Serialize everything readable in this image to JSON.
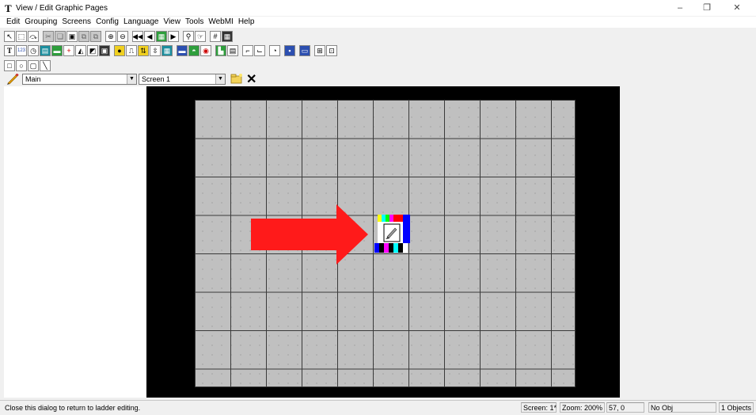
{
  "window": {
    "app_icon": "T",
    "title": "View / Edit Graphic Pages",
    "minimize": "–",
    "restore": "❐",
    "close": "✕"
  },
  "menu": [
    "Edit",
    "Grouping",
    "Screens",
    "Config",
    "Language",
    "View",
    "Tools",
    "WebMI",
    "Help"
  ],
  "toolbar_icons": {
    "row1": [
      "pointer-icon",
      "select-rect-icon",
      "connect-icon",
      "cut-icon",
      "copy-icon",
      "paste-icon",
      "duplicate-icon",
      "paste-special-icon",
      "zoom-in-icon",
      "zoom-out-icon",
      "first-screen-icon",
      "prev-screen-icon",
      "screen-list-icon",
      "next-screen-icon",
      "find-icon",
      "properties-icon",
      "grid-icon",
      "snap-grid-icon"
    ],
    "row2": [
      "text-tool-icon",
      "numeric-tool-icon",
      "clock-tool-icon",
      "data-tool-icon",
      "bitmap-tool-icon",
      "alarm-tool-icon",
      "gauge-tool-icon",
      "chart-tool-icon",
      "button-tool-icon",
      "light-tool-icon",
      "switch-tool-icon",
      "slider-tool-icon",
      "meter-tool-icon",
      "indicator-tool-icon",
      "sensor-tool-icon",
      "tank-tool-icon",
      "input-tool-icon",
      "display-tool-icon",
      "trend-tool-icon",
      "xy-plot-icon",
      "timer-tool-icon",
      "save-tool-icon",
      "message-tool-icon",
      "table-tool-icon",
      "frame-tool-icon"
    ],
    "row3": [
      "rectangle-tool-icon",
      "circle-tool-icon",
      "rounded-rect-tool-icon",
      "line-tool-icon"
    ]
  },
  "selectors": {
    "page": "Main",
    "screen": "Screen 1"
  },
  "status": {
    "message": "Close this dialog to return to ladder editing.",
    "screen": "Screen: 1*",
    "zoom": "Zoom: 200%",
    "coords": "57, 0",
    "object": "No Obj",
    "objects": "1 Objects"
  },
  "colors": {
    "arrow": "#ff1a1a",
    "canvas_bg": "#000000",
    "screen_bg": "#c0c0c0"
  }
}
